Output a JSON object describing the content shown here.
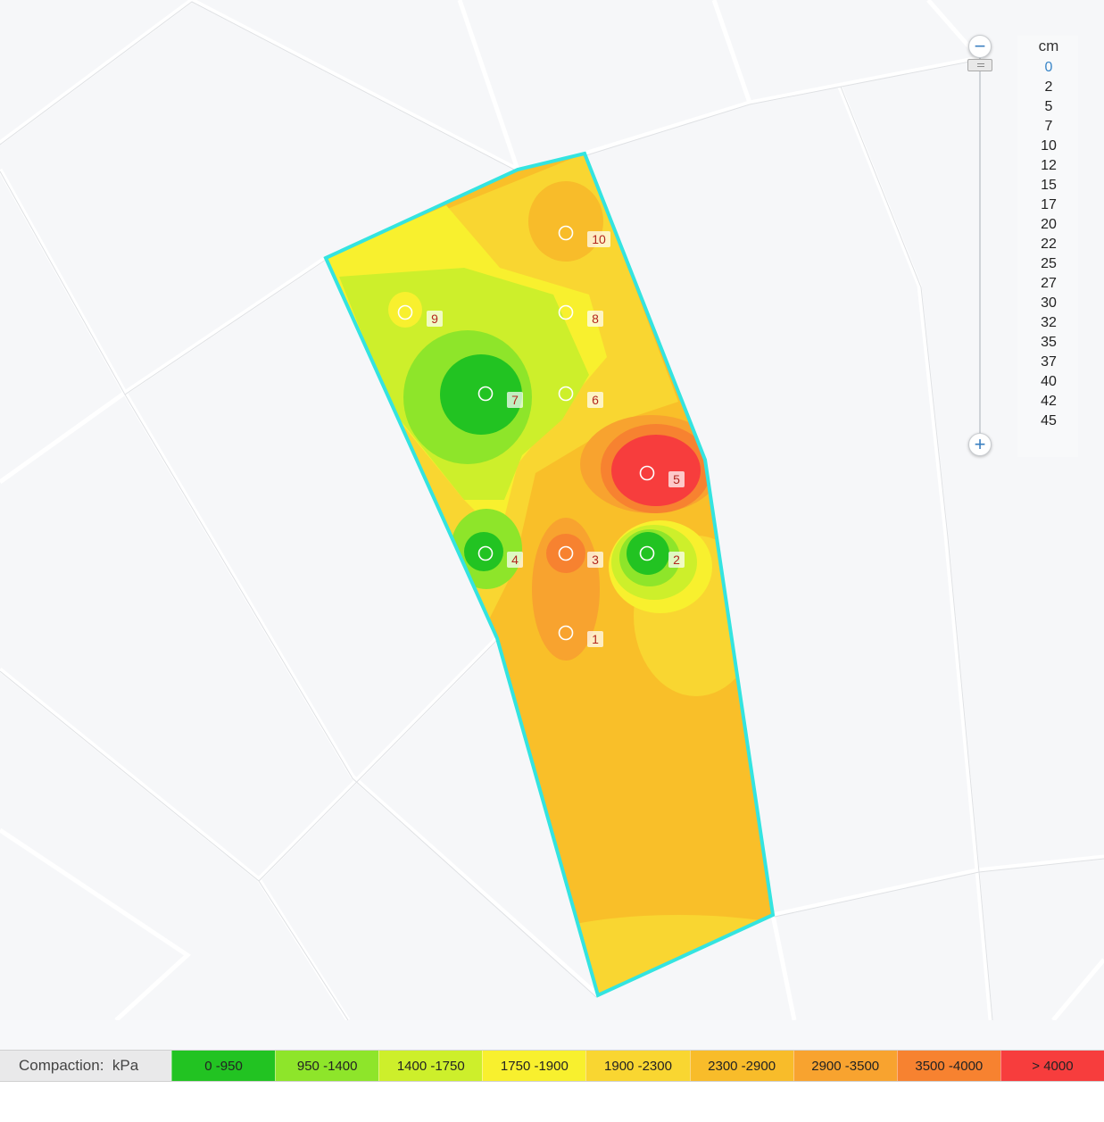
{
  "depth_scale": {
    "unit": "cm",
    "selected": "0",
    "values": [
      "0",
      "2",
      "5",
      "7",
      "10",
      "12",
      "15",
      "17",
      "20",
      "22",
      "25",
      "27",
      "30",
      "32",
      "35",
      "37",
      "40",
      "42",
      "45"
    ],
    "zoom_out_symbol": "−",
    "zoom_in_symbol": "+"
  },
  "sample_points": [
    "1",
    "2",
    "3",
    "4",
    "5",
    "6",
    "7",
    "8",
    "9",
    "10"
  ],
  "legend": {
    "title": "Compaction:  kPa",
    "classes": [
      {
        "label": "0 -950",
        "color": "#22c322"
      },
      {
        "label": "950 -1400",
        "color": "#8ee52a"
      },
      {
        "label": "1400 -1750",
        "color": "#cdef2b"
      },
      {
        "label": "1750 -1900",
        "color": "#f8f02e"
      },
      {
        "label": "1900 -2300",
        "color": "#f9d631"
      },
      {
        "label": "2300 -2900",
        "color": "#f8bc2a"
      },
      {
        "label": "2900 -3500",
        "color": "#f8a32f"
      },
      {
        "label": "3500 -4000",
        "color": "#f78230"
      },
      {
        "label": "> 4000",
        "color": "#f73d3d"
      }
    ]
  },
  "colors": {
    "field_boundary": "#34e4e0",
    "map_background": "#f6f7f9",
    "parcel_lines": "#ffffff",
    "accent": "#3a86c8"
  }
}
